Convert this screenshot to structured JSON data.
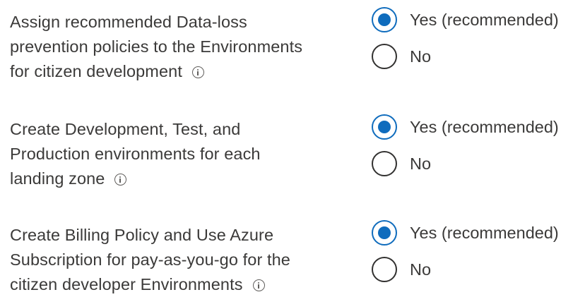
{
  "colors": {
    "accent": "#0f6cbd",
    "text": "#3b3a39",
    "radio_border": "#323130"
  },
  "questions": [
    {
      "lines": [
        "Assign recommended Data-loss",
        "prevention policies to the Environments",
        "for citizen development"
      ],
      "info_icon": "info-icon",
      "options": [
        {
          "label": "Yes (recommended)",
          "selected": true
        },
        {
          "label": "No",
          "selected": false
        }
      ]
    },
    {
      "lines": [
        "Create Development, Test, and",
        "Production environments for each",
        "landing zone"
      ],
      "info_icon": "info-icon",
      "options": [
        {
          "label": "Yes (recommended)",
          "selected": true
        },
        {
          "label": "No",
          "selected": false
        }
      ]
    },
    {
      "lines": [
        "Create Billing Policy and Use Azure",
        "Subscription for pay-as-you-go for the",
        "citizen developer Environments"
      ],
      "info_icon": "info-icon",
      "options": [
        {
          "label": "Yes (recommended)",
          "selected": true
        },
        {
          "label": "No",
          "selected": false
        }
      ]
    }
  ]
}
